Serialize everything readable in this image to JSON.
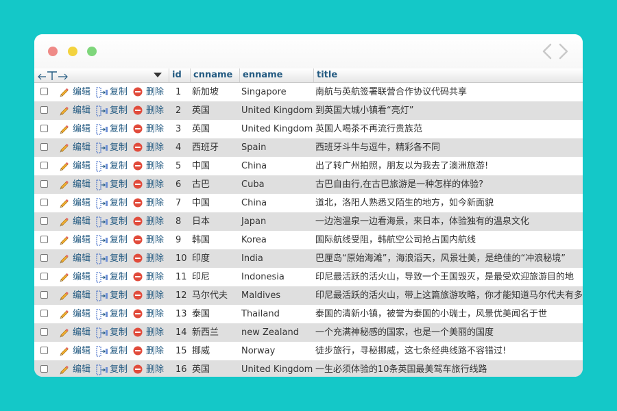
{
  "columns": {
    "id": "id",
    "cnname": "cnname",
    "enname": "enname",
    "title": "title"
  },
  "actions": {
    "edit": "编辑",
    "copy": "复制",
    "delete": "删除"
  },
  "colors": {
    "background": "#14c8c8",
    "link": "#235a81",
    "stripe": "#dfdfdf"
  },
  "rows": [
    {
      "id": "1",
      "cnname": "新加坡",
      "enname": "Singapore",
      "title": "南航与英航签署联营合作协议代码共享"
    },
    {
      "id": "2",
      "cnname": "英国",
      "enname": "United Kingdom",
      "title": "到英国大城小镇看“亮灯”"
    },
    {
      "id": "3",
      "cnname": "英国",
      "enname": "United Kingdom",
      "title": "英国人喝茶不再流行贵族范"
    },
    {
      "id": "4",
      "cnname": "西班牙",
      "enname": "Spain",
      "title": "西班牙斗牛与逗牛，精彩各不同"
    },
    {
      "id": "5",
      "cnname": "中国",
      "enname": "China",
      "title": "出了转广州拍照，朋友以为我去了澳洲旅游!"
    },
    {
      "id": "6",
      "cnname": "古巴",
      "enname": "Cuba",
      "title": "古巴自由行,在古巴旅游是一种怎样的体验?"
    },
    {
      "id": "7",
      "cnname": "中国",
      "enname": "China",
      "title": "道北，洛阳人熟悉又陌生的地方，如今新面貌"
    },
    {
      "id": "8",
      "cnname": "日本",
      "enname": "Japan",
      "title": "一边泡温泉一边看海景，来日本，体验独有的温泉文化"
    },
    {
      "id": "9",
      "cnname": "韩国",
      "enname": "Korea",
      "title": "国际航线受阻，韩航空公司抢占国内航线"
    },
    {
      "id": "10",
      "cnname": "印度",
      "enname": "India",
      "title": "巴厘岛“原始海滩”，海浪滔天，风景壮美，是绝佳的“冲浪秘境”"
    },
    {
      "id": "11",
      "cnname": "印尼",
      "enname": "Indonesia",
      "title": "印尼最活跃的活火山，导致一个王国毁灭，是最受欢迎旅游目的地"
    },
    {
      "id": "12",
      "cnname": "马尔代夫",
      "enname": "Maldives",
      "title": "印尼最活跃的活火山，带上这篇旅游攻略，你才能知道马尔代夫有多美"
    },
    {
      "id": "13",
      "cnname": "泰国",
      "enname": "Thailand",
      "title": "泰国的清新小镇，被誉为泰国的小瑞士，风景优美闻名于世"
    },
    {
      "id": "14",
      "cnname": "新西兰",
      "enname": "new Zealand",
      "title": "一个充满神秘感的国家，也是一个美丽的国度"
    },
    {
      "id": "15",
      "cnname": "挪威",
      "enname": "Norway",
      "title": "徒步旅行，寻秘挪威，这七条经典线路不容错过!"
    },
    {
      "id": "16",
      "cnname": "英国",
      "enname": "United Kingdom",
      "title": "一生必须体验的10条英国最美驾车旅行线路"
    }
  ]
}
